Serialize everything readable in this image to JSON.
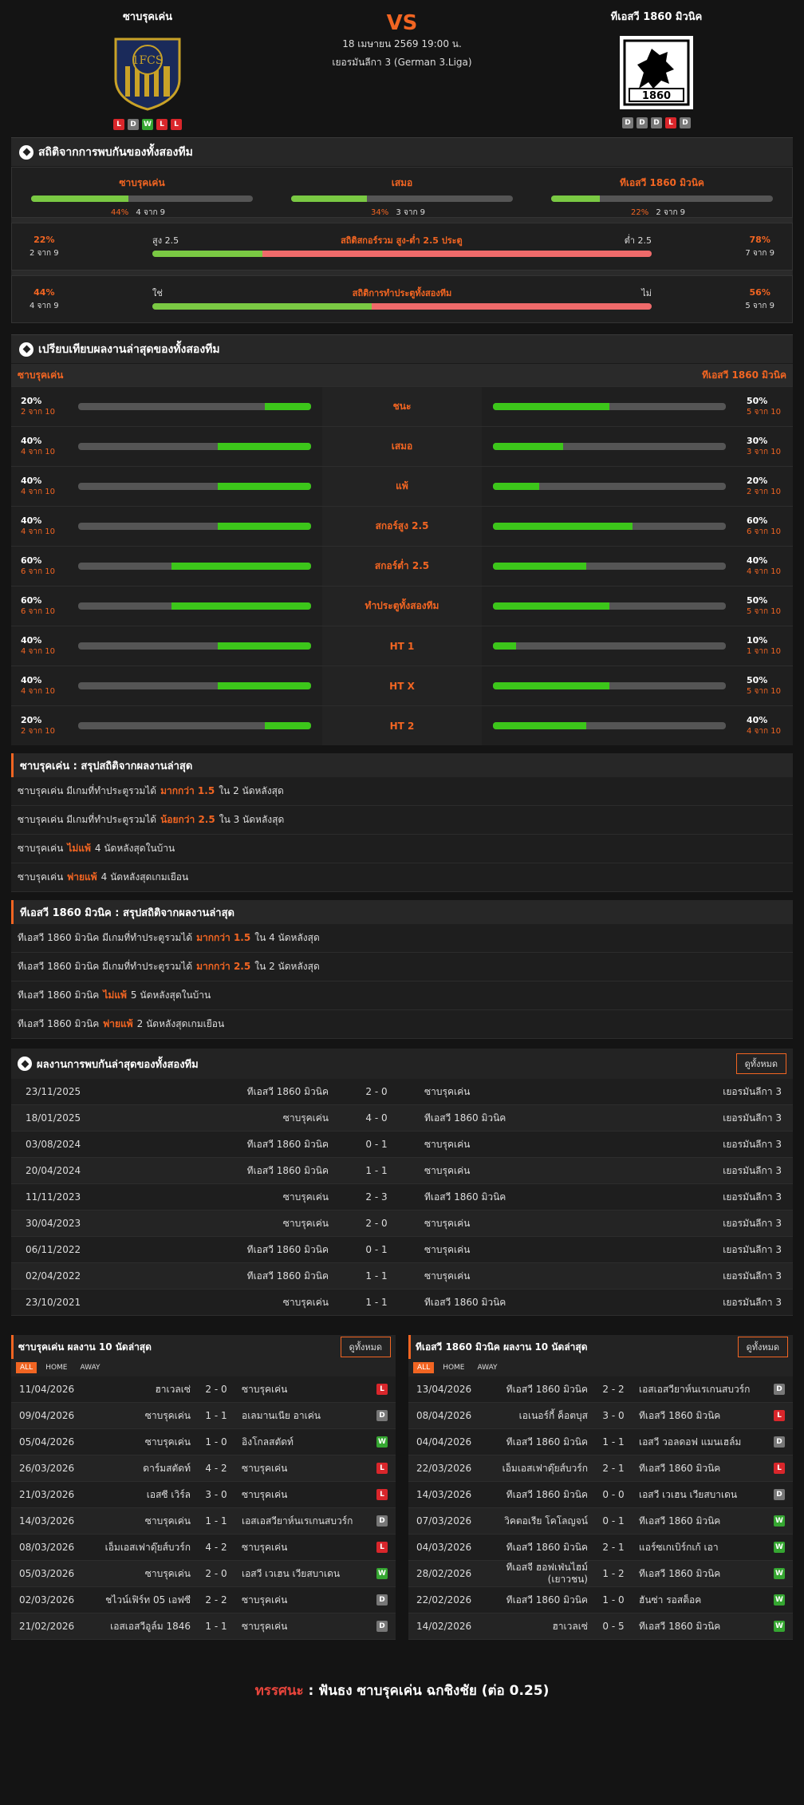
{
  "header": {
    "home_name": "ซาบรุคเค่น",
    "away_name": "ทีเอสวี 1860 มิวนิค",
    "vs": "VS",
    "datetime": "18 เมษายน 2569 19:00 น.",
    "league": "เยอรมันลีกา 3 (German 3.Liga)",
    "home_form": [
      "L",
      "D",
      "W",
      "L",
      "L"
    ],
    "away_form": [
      "D",
      "D",
      "D",
      "L",
      "D"
    ],
    "home_logo_text": "1FCS",
    "away_logo_text": "1860"
  },
  "h2h_stats": {
    "title": "สถิติจากการพบกันของทั้งสองทีม",
    "cols": [
      {
        "label": "ซาบรุคเค่น",
        "pct": "44%",
        "sub": "4 จาก 9",
        "v": 44
      },
      {
        "label": "เสมอ",
        "pct": "34%",
        "sub": "3 จาก 9",
        "v": 34
      },
      {
        "label": "ทีเอสวี 1860 มิวนิค",
        "pct": "22%",
        "sub": "2 จาก 9",
        "v": 22
      }
    ],
    "ou": {
      "l_pct": "22%",
      "l_sub": "2 จาก 9",
      "r_pct": "78%",
      "r_sub": "7 จาก 9",
      "l_lab": "สูง 2.5",
      "title": "สถิติสกอร์รวม สูง-ต่ำ 2.5 ประตู",
      "r_lab": "ต่ำ 2.5",
      "v": 22
    },
    "btts": {
      "l_pct": "44%",
      "l_sub": "4 จาก 9",
      "r_pct": "56%",
      "r_sub": "5 จาก 9",
      "l_lab": "ใช่",
      "title": "สถิติการทำประตูทั้งสองทีม",
      "r_lab": "ไม่",
      "v": 44
    }
  },
  "compare": {
    "title": "เปรียบเทียบผลงานล่าสุดของทั้งสองทีม",
    "home": "ซาบรุคเค่น",
    "away": "ทีเอสวี 1860 มิวนิค",
    "rows": [
      {
        "label": "ชนะ",
        "lp": "20%",
        "ls": "2 จาก 10",
        "lv": 20,
        "rp": "50%",
        "rs": "5 จาก 10",
        "rv": 50
      },
      {
        "label": "เสมอ",
        "lp": "40%",
        "ls": "4 จาก 10",
        "lv": 40,
        "rp": "30%",
        "rs": "3 จาก 10",
        "rv": 30
      },
      {
        "label": "แพ้",
        "lp": "40%",
        "ls": "4 จาก 10",
        "lv": 40,
        "rp": "20%",
        "rs": "2 จาก 10",
        "rv": 20
      },
      {
        "label": "สกอร์สูง 2.5",
        "lp": "40%",
        "ls": "4 จาก 10",
        "lv": 40,
        "rp": "60%",
        "rs": "6 จาก 10",
        "rv": 60
      },
      {
        "label": "สกอร์ต่ำ 2.5",
        "lp": "60%",
        "ls": "6 จาก 10",
        "lv": 60,
        "rp": "40%",
        "rs": "4 จาก 10",
        "rv": 40
      },
      {
        "label": "ทำประตูทั้งสองทีม",
        "lp": "60%",
        "ls": "6 จาก 10",
        "lv": 60,
        "rp": "50%",
        "rs": "5 จาก 10",
        "rv": 50
      },
      {
        "label": "HT 1",
        "lp": "40%",
        "ls": "4 จาก 10",
        "lv": 40,
        "rp": "10%",
        "rs": "1 จาก 10",
        "rv": 10
      },
      {
        "label": "HT X",
        "lp": "40%",
        "ls": "4 จาก 10",
        "lv": 40,
        "rp": "50%",
        "rs": "5 จาก 10",
        "rv": 50
      },
      {
        "label": "HT 2",
        "lp": "20%",
        "ls": "2 จาก 10",
        "lv": 20,
        "rp": "40%",
        "rs": "4 จาก 10",
        "rv": 40
      }
    ]
  },
  "sum_home": {
    "title": "ซาบรุคเค่น : สรุปสถิติจากผลงานล่าสุด",
    "rows": [
      {
        "a": "ซาบรุคเค่น  มีเกมที่ทำประตูรวมได้",
        "b": "มากกว่า 1.5",
        "c": "ใน 2 นัดหลังสุด"
      },
      {
        "a": "ซาบรุคเค่น  มีเกมที่ทำประตูรวมได้",
        "b": "น้อยกว่า 2.5",
        "c": "ใน 3 นัดหลังสุด"
      },
      {
        "a": "ซาบรุคเค่น",
        "b": "ไม่แพ้",
        "c": "4  นัดหลังสุดในบ้าน"
      },
      {
        "a": "ซาบรุคเค่น",
        "b": "พ่ายแพ้",
        "c": "4  นัดหลังสุดเกมเยือน"
      }
    ]
  },
  "sum_away": {
    "title": "ทีเอสวี 1860 มิวนิค : สรุปสถิติจากผลงานล่าสุด",
    "rows": [
      {
        "a": "ทีเอสวี 1860 มิวนิค  มีเกมที่ทำประตูรวมได้",
        "b": "มากกว่า 1.5",
        "c": "ใน 4 นัดหลังสุด"
      },
      {
        "a": "ทีเอสวี 1860 มิวนิค  มีเกมที่ทำประตูรวมได้",
        "b": "มากกว่า 2.5",
        "c": "ใน 2 นัดหลังสุด"
      },
      {
        "a": "ทีเอสวี 1860 มิวนิค",
        "b": "ไม่แพ้",
        "c": "5  นัดหลังสุดในบ้าน"
      },
      {
        "a": "ทีเอสวี 1860 มิวนิค",
        "b": "พ่ายแพ้",
        "c": "2  นัดหลังสุดเกมเยือน"
      }
    ]
  },
  "h2h_list": {
    "title": "ผลงานการพบกันล่าสุดของทั้งสองทีม",
    "btn": "ดูทั้งหมด",
    "rows": [
      [
        "23/11/2025",
        "ทีเอสวี 1860 มิวนิค",
        "2 - 0",
        "ซาบรุคเค่น",
        "เยอรมันลีกา 3"
      ],
      [
        "18/01/2025",
        "ซาบรุคเค่น",
        "4 - 0",
        "ทีเอสวี 1860 มิวนิค",
        "เยอรมันลีกา 3"
      ],
      [
        "03/08/2024",
        "ทีเอสวี 1860 มิวนิค",
        "0 - 1",
        "ซาบรุคเค่น",
        "เยอรมันลีกา 3"
      ],
      [
        "20/04/2024",
        "ทีเอสวี 1860 มิวนิค",
        "1 - 1",
        "ซาบรุคเค่น",
        "เยอรมันลีกา 3"
      ],
      [
        "11/11/2023",
        "ซาบรุคเค่น",
        "2 - 3",
        "ทีเอสวี 1860 มิวนิค",
        "เยอรมันลีกา 3"
      ],
      [
        "30/04/2023",
        "ซาบรุคเค่น",
        "2 - 0",
        "ซาบรุคเค่น",
        "เยอรมันลีกา 3"
      ],
      [
        "06/11/2022",
        "ทีเอสวี 1860 มิวนิค",
        "0 - 1",
        "ซาบรุคเค่น",
        "เยอรมันลีกา 3"
      ],
      [
        "02/04/2022",
        "ทีเอสวี 1860 มิวนิค",
        "1 - 1",
        "ซาบรุคเค่น",
        "เยอรมันลีกา 3"
      ],
      [
        "23/10/2021",
        "ซาบรุคเค่น",
        "1 - 1",
        "ทีเอสวี 1860 มิวนิค",
        "เยอรมันลีกา 3"
      ]
    ]
  },
  "last10_home": {
    "title": "ซาบรุคเค่น ผลงาน 10 นัดล่าสุด",
    "btn": "ดูทั้งหมด",
    "tabs": [
      "ALL",
      "HOME",
      "AWAY"
    ],
    "rows": [
      [
        "11/04/2026",
        "ฮาเวลเซ่",
        "2 - 0",
        "ซาบรุคเค่น",
        "L"
      ],
      [
        "09/04/2026",
        "ซาบรุคเค่น",
        "1 - 1",
        "อเลมานเนีย อาเค่น",
        "D"
      ],
      [
        "05/04/2026",
        "ซาบรุคเค่น",
        "1 - 0",
        "อิงโกลสตัดท์",
        "W"
      ],
      [
        "26/03/2026",
        "ดาร์มสตัดท์",
        "4 - 2",
        "ซาบรุคเค่น",
        "L"
      ],
      [
        "21/03/2026",
        "เอสซี เวิร์ล",
        "3 - 0",
        "ซาบรุคเค่น",
        "L"
      ],
      [
        "14/03/2026",
        "ซาบรุคเค่น",
        "1 - 1",
        "เอสเอสวียาห์นเรเกนสบวร์ก",
        "D"
      ],
      [
        "08/03/2026",
        "เอ็มเอสเฟาดุ๊ยส์บวร์ก",
        "4 - 2",
        "ซาบรุคเค่น",
        "L"
      ],
      [
        "05/03/2026",
        "ซาบรุคเค่น",
        "2 - 0",
        "เอสวี เวเฮน เวียสบาเดน",
        "W"
      ],
      [
        "02/03/2026",
        "ชไวน์เฟิร์ท 05 เอฟซี",
        "2 - 2",
        "ซาบรุคเค่น",
        "D"
      ],
      [
        "21/02/2026",
        "เอสเอสวีอูล์ม 1846",
        "1 - 1",
        "ซาบรุคเค่น",
        "D"
      ]
    ]
  },
  "last10_away": {
    "title": "ทีเอสวี 1860 มิวนิค ผลงาน 10 นัดล่าสุด",
    "btn": "ดูทั้งหมด",
    "tabs": [
      "ALL",
      "HOME",
      "AWAY"
    ],
    "rows": [
      [
        "13/04/2026",
        "ทีเอสวี 1860 มิวนิค",
        "2 - 2",
        "เอสเอสวียาห์นเรเกนสบวร์ก",
        "D"
      ],
      [
        "08/04/2026",
        "เอเนอร์กี้ ค็อตบุส",
        "3 - 0",
        "ทีเอสวี 1860 มิวนิค",
        "L"
      ],
      [
        "04/04/2026",
        "ทีเอสวี 1860 มิวนิค",
        "1 - 1",
        "เอสวี วอลดอฟ แมนเฮล์ม",
        "D"
      ],
      [
        "22/03/2026",
        "เอ็มเอสเฟาดุ๊ยส์บวร์ก",
        "2 - 1",
        "ทีเอสวี 1860 มิวนิค",
        "L"
      ],
      [
        "14/03/2026",
        "ทีเอสวี 1860 มิวนิค",
        "0 - 0",
        "เอสวี เวเฮน เวียสบาเดน",
        "D"
      ],
      [
        "07/03/2026",
        "วิคตอเรีย โคโลญจน์",
        "0 - 1",
        "ทีเอสวี 1860 มิวนิค",
        "W"
      ],
      [
        "04/03/2026",
        "ทีเอสวี 1860 มิวนิค",
        "2 - 1",
        "แอร์ซเกเบิร์กเก้ เอา",
        "W"
      ],
      [
        "28/02/2026",
        "ทีเอสจี ฮอฟเฟ่นไฮม์ (เยาวชน)",
        "1 - 2",
        "ทีเอสวี 1860 มิวนิค",
        "W"
      ],
      [
        "22/02/2026",
        "ทีเอสวี 1860 มิวนิค",
        "1 - 0",
        "ฮันซ่า รอสต็อค",
        "W"
      ],
      [
        "14/02/2026",
        "ฮาเวลเซ่",
        "0 - 5",
        "ทีเอสวี 1860 มิวนิค",
        "W"
      ]
    ]
  },
  "footer": {
    "label": "ทรรศนะ",
    "sep": ":",
    "text": "ฟันธง ซาบรุคเค่น ฉกชิงชัย (ต่อ 0.25)"
  },
  "colors": {
    "accent": "#f26522",
    "green": "#7ac943",
    "red": "#ef6a6a"
  }
}
